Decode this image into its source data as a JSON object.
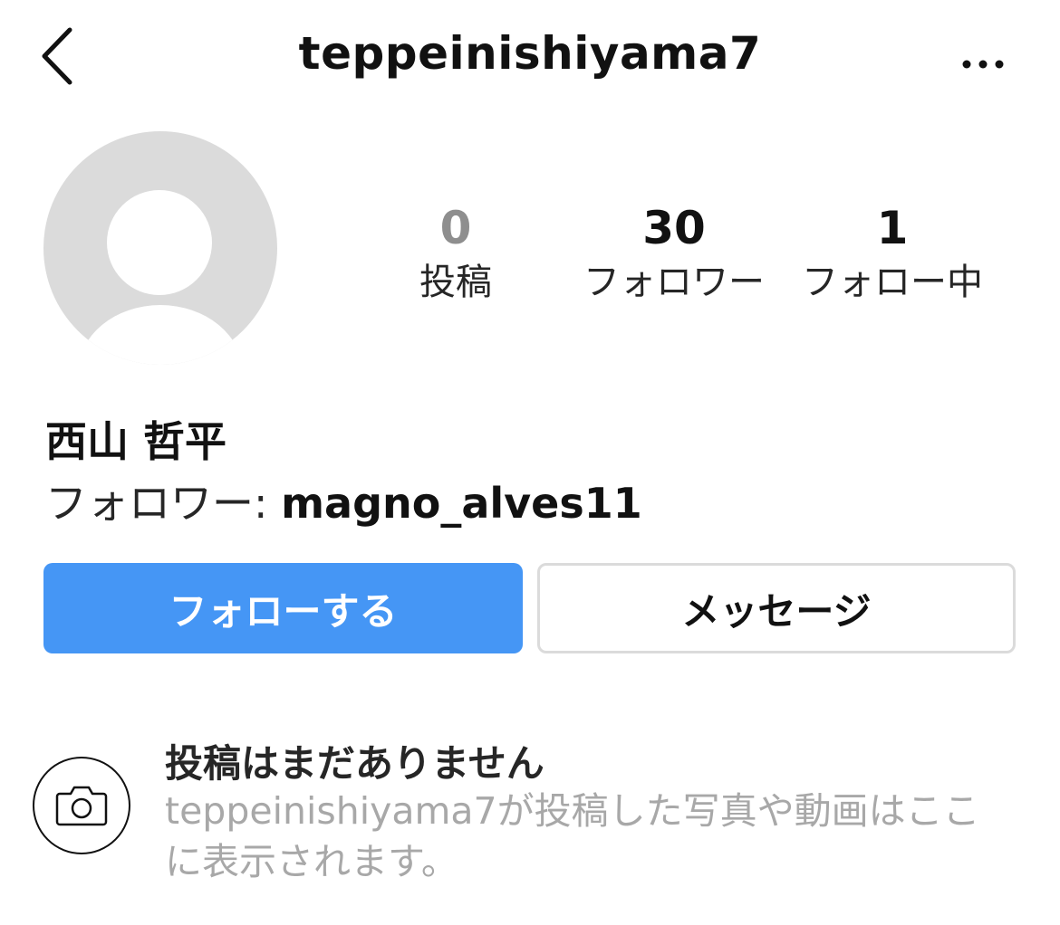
{
  "header": {
    "username": "teppeinishiyama7",
    "back_icon": "chevron-left-icon",
    "more_icon": "more-horizontal-icon"
  },
  "profile": {
    "avatar_icon": "default-avatar-icon",
    "stats": {
      "posts": {
        "count": "0",
        "label": "投稿"
      },
      "followers": {
        "count": "30",
        "label": "フォロワー"
      },
      "following": {
        "count": "1",
        "label": "フォロー中"
      }
    },
    "display_name": "西山 哲平",
    "followed_by_prefix": "フォロワー: ",
    "followed_by_user": "magno_alves11"
  },
  "actions": {
    "follow_label": "フォローする",
    "message_label": "メッセージ"
  },
  "empty_state": {
    "icon": "camera-icon",
    "title": "投稿はまだありません",
    "description": "teppeinishiyama7が投稿した写真や動画はここに表示されます。"
  },
  "colors": {
    "follow_button": "#4596f5",
    "avatar_placeholder": "#dbdbdb",
    "muted_text": "#a8a8a8"
  }
}
